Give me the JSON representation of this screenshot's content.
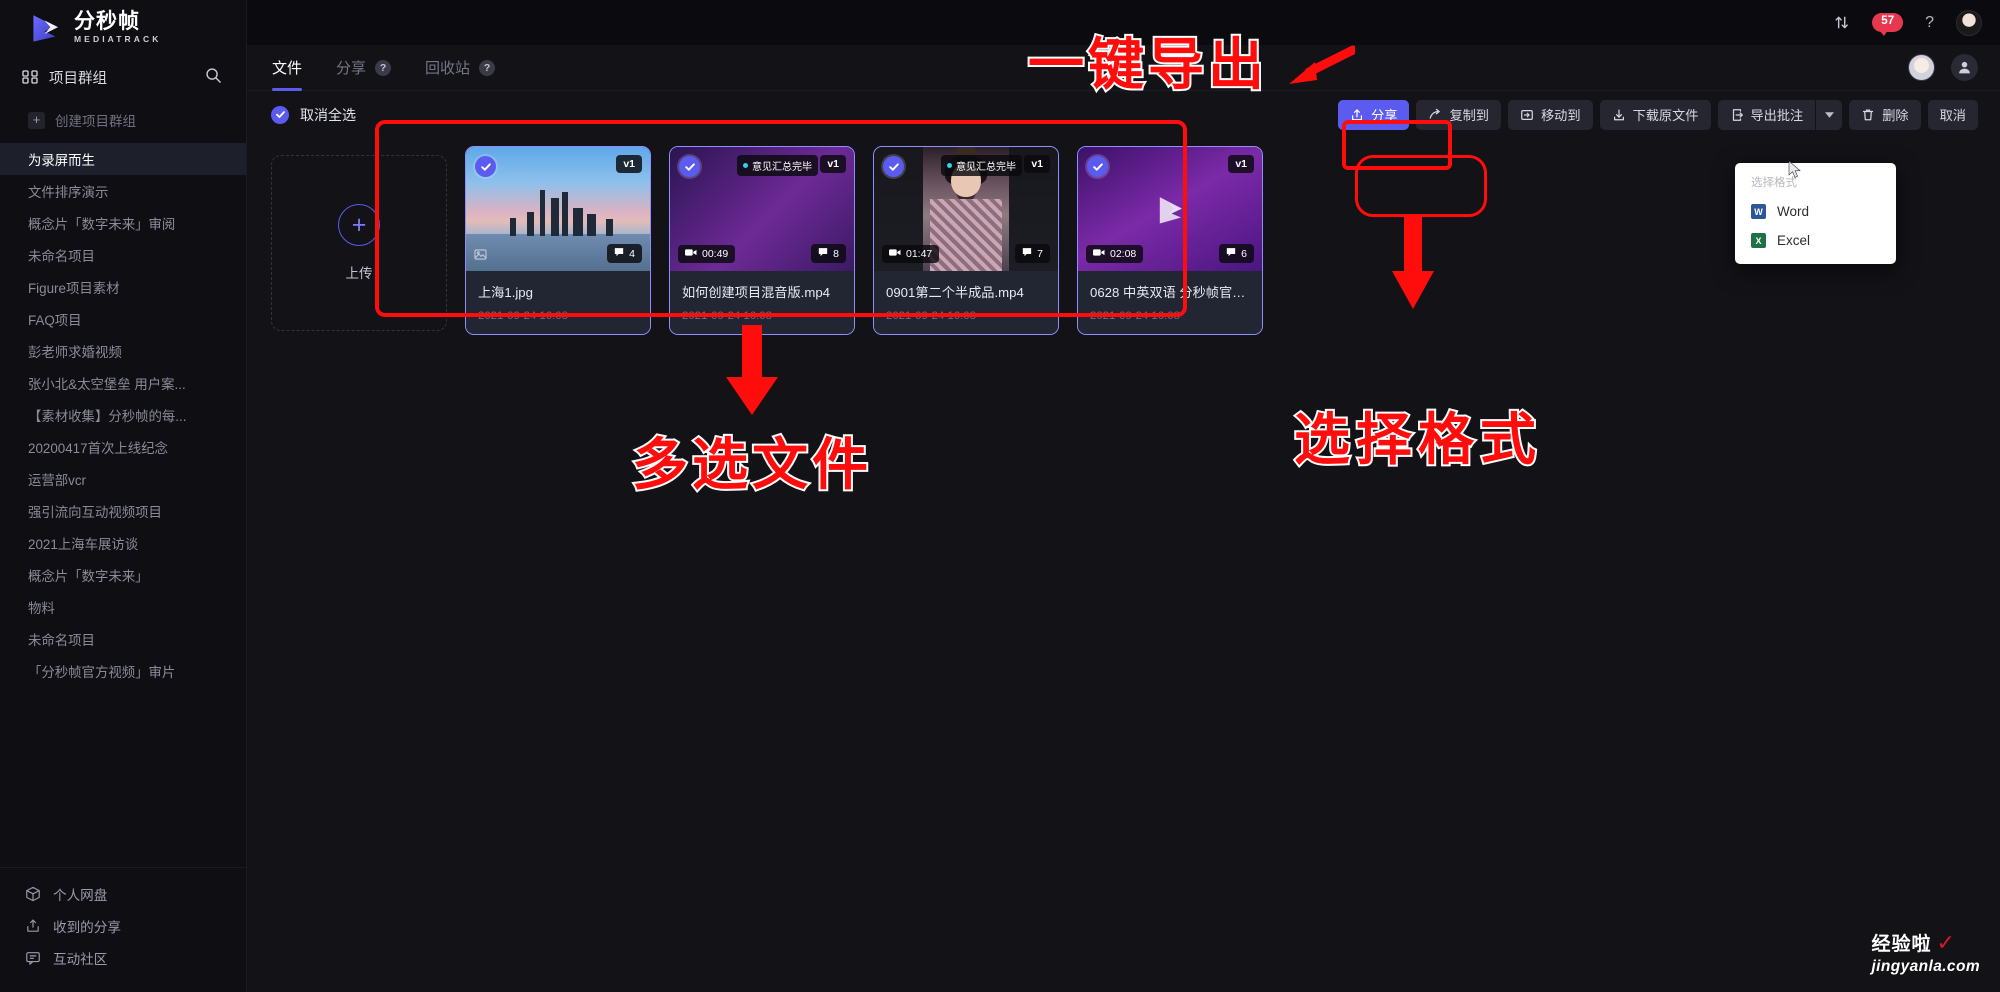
{
  "brand": {
    "name_cn": "分秒帧",
    "name_en": "MEDIATRACK",
    "logo_icon": "mediatrack-logo-icon"
  },
  "sidebar": {
    "group_header": {
      "label": "项目群组",
      "icon": "group-icon",
      "search_icon": "search-icon"
    },
    "create": {
      "label": "创建项目群组",
      "icon": "plus-icon"
    },
    "projects": [
      {
        "label": "为录屏而生",
        "active": true
      },
      {
        "label": "文件排序演示",
        "active": false
      },
      {
        "label": "概念片「数字未来」审阅",
        "active": false
      },
      {
        "label": "未命名项目",
        "active": false
      },
      {
        "label": "Figure项目素材",
        "active": false
      },
      {
        "label": "FAQ项目",
        "active": false
      },
      {
        "label": "彭老师求婚视频",
        "active": false
      },
      {
        "label": "张小北&太空堡垒 用户案...",
        "active": false
      },
      {
        "label": "【素材收集】分秒帧的每...",
        "active": false
      },
      {
        "label": "20200417首次上线纪念",
        "active": false
      },
      {
        "label": "运营部vcr",
        "active": false
      },
      {
        "label": "强引流向互动视频项目",
        "active": false
      },
      {
        "label": "2021上海车展访谈",
        "active": false
      },
      {
        "label": "概念片「数字未来」",
        "active": false
      },
      {
        "label": "物料",
        "active": false
      },
      {
        "label": "未命名项目",
        "active": false
      },
      {
        "label": "「分秒帧官方视频」审片",
        "active": false
      }
    ],
    "footer": [
      {
        "label": "个人网盘",
        "icon": "cube-icon"
      },
      {
        "label": "收到的分享",
        "icon": "share-inbox-icon"
      },
      {
        "label": "互动社区",
        "icon": "comment-icon"
      }
    ]
  },
  "topbar": {
    "transfer_icon": "transfer-updown-icon",
    "notification_count": "57",
    "help_icon": "help-question-icon",
    "avatar_icon": "user-avatar"
  },
  "tabs": [
    {
      "label": "文件",
      "badge": null,
      "active": true
    },
    {
      "label": "分享",
      "badge": "?",
      "active": false
    },
    {
      "label": "回收站",
      "badge": "?",
      "active": false
    }
  ],
  "actionbar": {
    "select_all_label": "取消全选",
    "select_all_checked": true,
    "buttons": [
      {
        "label": "分享",
        "icon": "share-icon",
        "primary": true
      },
      {
        "label": "复制到",
        "icon": "copy-to-icon",
        "primary": false
      },
      {
        "label": "移动到",
        "icon": "move-to-icon",
        "primary": false
      },
      {
        "label": "下载原文件",
        "icon": "download-icon",
        "primary": false
      },
      {
        "label": "导出批注",
        "icon": "export-icon",
        "primary": false,
        "has_caret": true
      },
      {
        "label": "删除",
        "icon": "trash-icon",
        "primary": false
      },
      {
        "label": "取消",
        "icon": null,
        "primary": false
      }
    ]
  },
  "upload": {
    "label": "上传",
    "icon": "plus-icon"
  },
  "files": [
    {
      "name": "上海1.jpg",
      "time": "2021-09-24 16:08",
      "version": "v1",
      "comments": "4",
      "duration": null,
      "status": null,
      "selected": true,
      "thumb_kind": "city",
      "image_icon": "image-icon"
    },
    {
      "name": "如何创建项目混音版.mp4",
      "time": "2021-09-24 16:08",
      "version": "v1",
      "comments": "8",
      "duration": "00:49",
      "status": "意见汇总完毕",
      "selected": true,
      "thumb_kind": "purple",
      "image_icon": null
    },
    {
      "name": "0901第二个半成品.mp4",
      "time": "2021-09-24 16:08",
      "version": "v1",
      "comments": "7",
      "duration": "01:47",
      "status": "意见汇总完毕",
      "selected": true,
      "thumb_kind": "girl",
      "image_icon": null
    },
    {
      "name": "0628 中英双语 分秒帧官方... ....",
      "time": "2021-09-24 16:08",
      "version": "v1",
      "comments": "6",
      "duration": "02:08",
      "status": null,
      "selected": true,
      "thumb_kind": "purple2",
      "image_icon": null
    }
  ],
  "dropdown": {
    "title": "选择格式",
    "items": [
      {
        "label": "Word",
        "icon": "word-icon",
        "glyph": "W"
      },
      {
        "label": "Excel",
        "icon": "excel-icon",
        "glyph": "X"
      }
    ]
  },
  "annotations": {
    "export_label": "一键导出",
    "format_label": "选择格式",
    "multiselect_label": "多选文件",
    "accent_red": "#ff0d0d"
  },
  "watermark": {
    "cn": "经验啦",
    "en": "jingyanla.com",
    "check_icon": "check-mark-icon"
  },
  "colors": {
    "accent": "#5b5bf0",
    "badge_red": "#e8384f",
    "status_cyan": "#31d2e8",
    "annotation_red": "#ff0d0d"
  }
}
